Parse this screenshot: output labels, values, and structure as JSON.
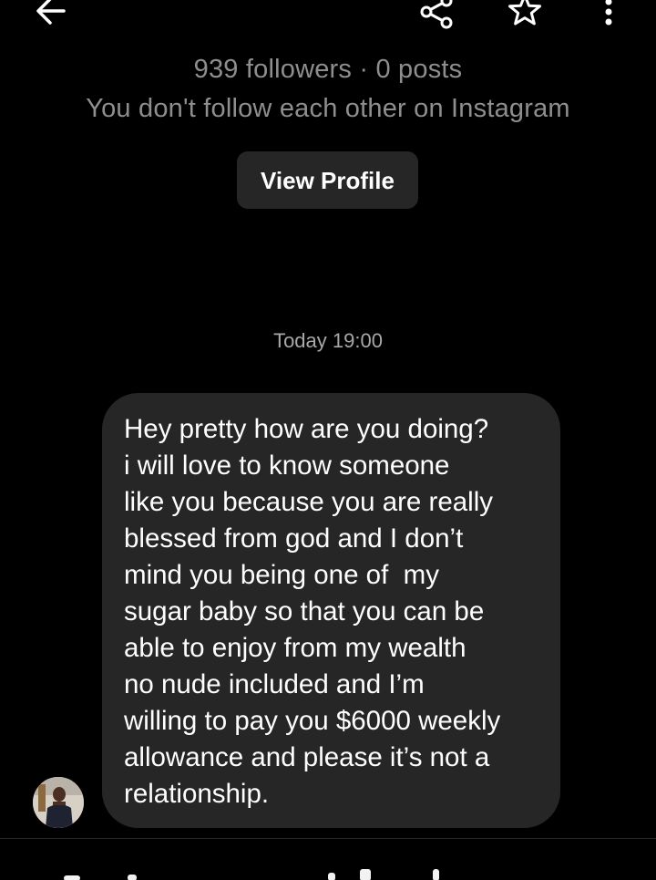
{
  "header": {
    "back_icon": "arrow-left-icon",
    "share_icon": "share-icon",
    "star_icon": "star-outline-icon",
    "more_icon": "more-vertical-icon"
  },
  "profile": {
    "stats": "939 followers · 0 posts",
    "follow_status": "You don't follow each other on Instagram",
    "view_profile_label": "View Profile"
  },
  "thread": {
    "timestamp": "Today 19:00",
    "message_lines": [
      "Hey pretty how are you doing?",
      "i will love to know someone",
      "like you because you are really",
      "blessed from god and I don’t",
      "mind you being one of  my",
      "sugar baby so that you can be",
      "able to enjoy from my wealth",
      "no nude included and I’m",
      "willing to pay you $6000 weekly",
      "allowance and please it’s not a",
      "relationship."
    ]
  },
  "colors": {
    "background": "#000000",
    "bubble": "#262626",
    "secondary_text": "#8e8e8e",
    "button": "#262626"
  }
}
